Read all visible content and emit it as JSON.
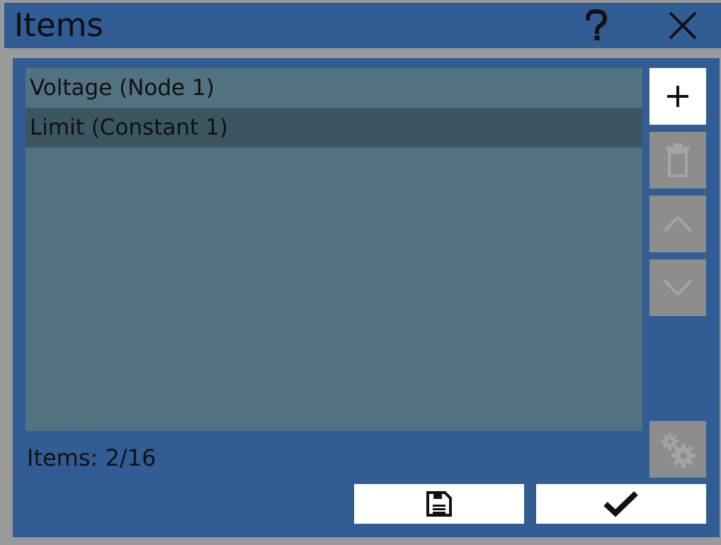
{
  "window": {
    "title": "Items",
    "help_icon": "question-mark-icon",
    "close_icon": "close-x-icon"
  },
  "list": {
    "items": [
      {
        "label": "Voltage (Node 1)",
        "selected": false
      },
      {
        "label": "Limit (Constant 1)",
        "selected": true
      }
    ]
  },
  "side_buttons": {
    "add": {
      "icon": "plus-icon",
      "enabled": true
    },
    "delete": {
      "icon": "trash-icon",
      "enabled": false
    },
    "move_up": {
      "icon": "chevron-up-icon",
      "enabled": false
    },
    "move_down": {
      "icon": "chevron-down-icon",
      "enabled": false
    },
    "settings": {
      "icon": "gears-icon",
      "enabled": false
    }
  },
  "status": {
    "items_count": "Items: 2/16"
  },
  "footer": {
    "save_icon": "floppy-save-icon",
    "confirm_icon": "checkmark-icon"
  },
  "colors": {
    "title_bar": "#315c94",
    "panel": "#315c94",
    "frame": "#9a9a9a",
    "list_background": "#527282",
    "list_selected": "#3b5660",
    "button_enabled": "#ffffff",
    "button_disabled": "#8d8d8d"
  }
}
